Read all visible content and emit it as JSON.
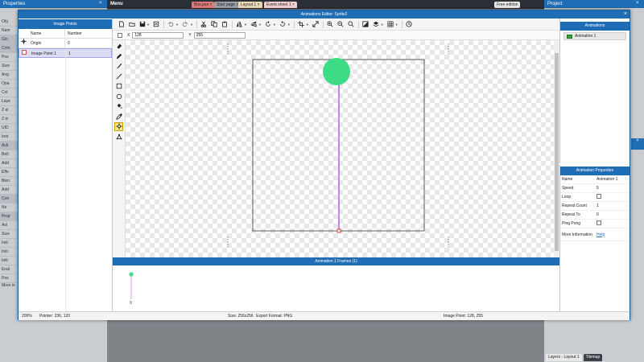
{
  "background": {
    "left_panel_title": "Properties",
    "left_items": [
      "Obj",
      "Nam",
      "Glo",
      "Com",
      "Pos",
      "Size",
      "Ang",
      "Opa",
      "Col",
      "Laye",
      "Z el",
      "Z in",
      "UID",
      "Inst",
      "Acti",
      "Beh",
      "Add",
      "Effe",
      "Blen",
      "Add",
      "Con",
      "No",
      "Prop",
      "Ani",
      "Size",
      "Initi",
      "Initi",
      "Initi",
      "Enal",
      "Pos"
    ],
    "more_info": "More in",
    "menu_label": "Menu",
    "tabs": [
      {
        "label": "Box.pos",
        "color": "#e07a7a"
      },
      {
        "label": "Start page",
        "color": "#9aa0a6"
      },
      {
        "label": "Layout 1",
        "color": "#e9d9b9"
      },
      {
        "label": "Event sheet 1",
        "color": "#f5d0d0"
      }
    ],
    "free_edition": "Free edition",
    "right_panel_title": "Project",
    "bottom_tabs": [
      "Layers - Layout 1",
      "Tilemap"
    ]
  },
  "editor": {
    "title": "Animations Editor: Sprite2",
    "close_glyph": "×"
  },
  "image_points": {
    "title": "Image Points",
    "columns": {
      "name": "Name",
      "number": "Number"
    },
    "rows": [
      {
        "name": "Origin",
        "number": "0",
        "icon": "origin-crosshair-icon",
        "selected": false
      },
      {
        "name": "Image Point 1",
        "number": "1",
        "icon": "image-point-icon",
        "selected": true
      }
    ]
  },
  "coords": {
    "x_label": "X",
    "x_value": "128",
    "y_label": "Y",
    "y_value": "255"
  },
  "frames": {
    "title": "Animation 1 Frames (1)",
    "frame_number": "0"
  },
  "animations": {
    "title": "Animations",
    "items": [
      {
        "label": "Animation 1",
        "color": "#3aa23a"
      }
    ]
  },
  "animation_properties": {
    "title": "Animation Properties",
    "rows": [
      {
        "key": "Name",
        "value": "Animation 1",
        "type": "text"
      },
      {
        "key": "Speed",
        "value": "5",
        "type": "text"
      },
      {
        "key": "Loop",
        "value": "",
        "type": "checkbox"
      },
      {
        "key": "Repeat Count",
        "value": "1",
        "type": "text"
      },
      {
        "key": "Repeat To",
        "value": "0",
        "type": "text"
      },
      {
        "key": "Ping Pong",
        "value": "",
        "type": "checkbox"
      },
      {
        "key": "More Information",
        "value": "Help",
        "type": "link"
      }
    ]
  },
  "status": {
    "zoom": "200%",
    "pointer": "Pointer: 236, 120",
    "size": "Size: 256x256",
    "export": "Export Format: PNG",
    "image_point": "Image Point: 128, 255"
  },
  "colors": {
    "accent": "#1f6db5",
    "circle": "#3ddc84",
    "line": "#c04fe0",
    "point": "#e04040"
  }
}
